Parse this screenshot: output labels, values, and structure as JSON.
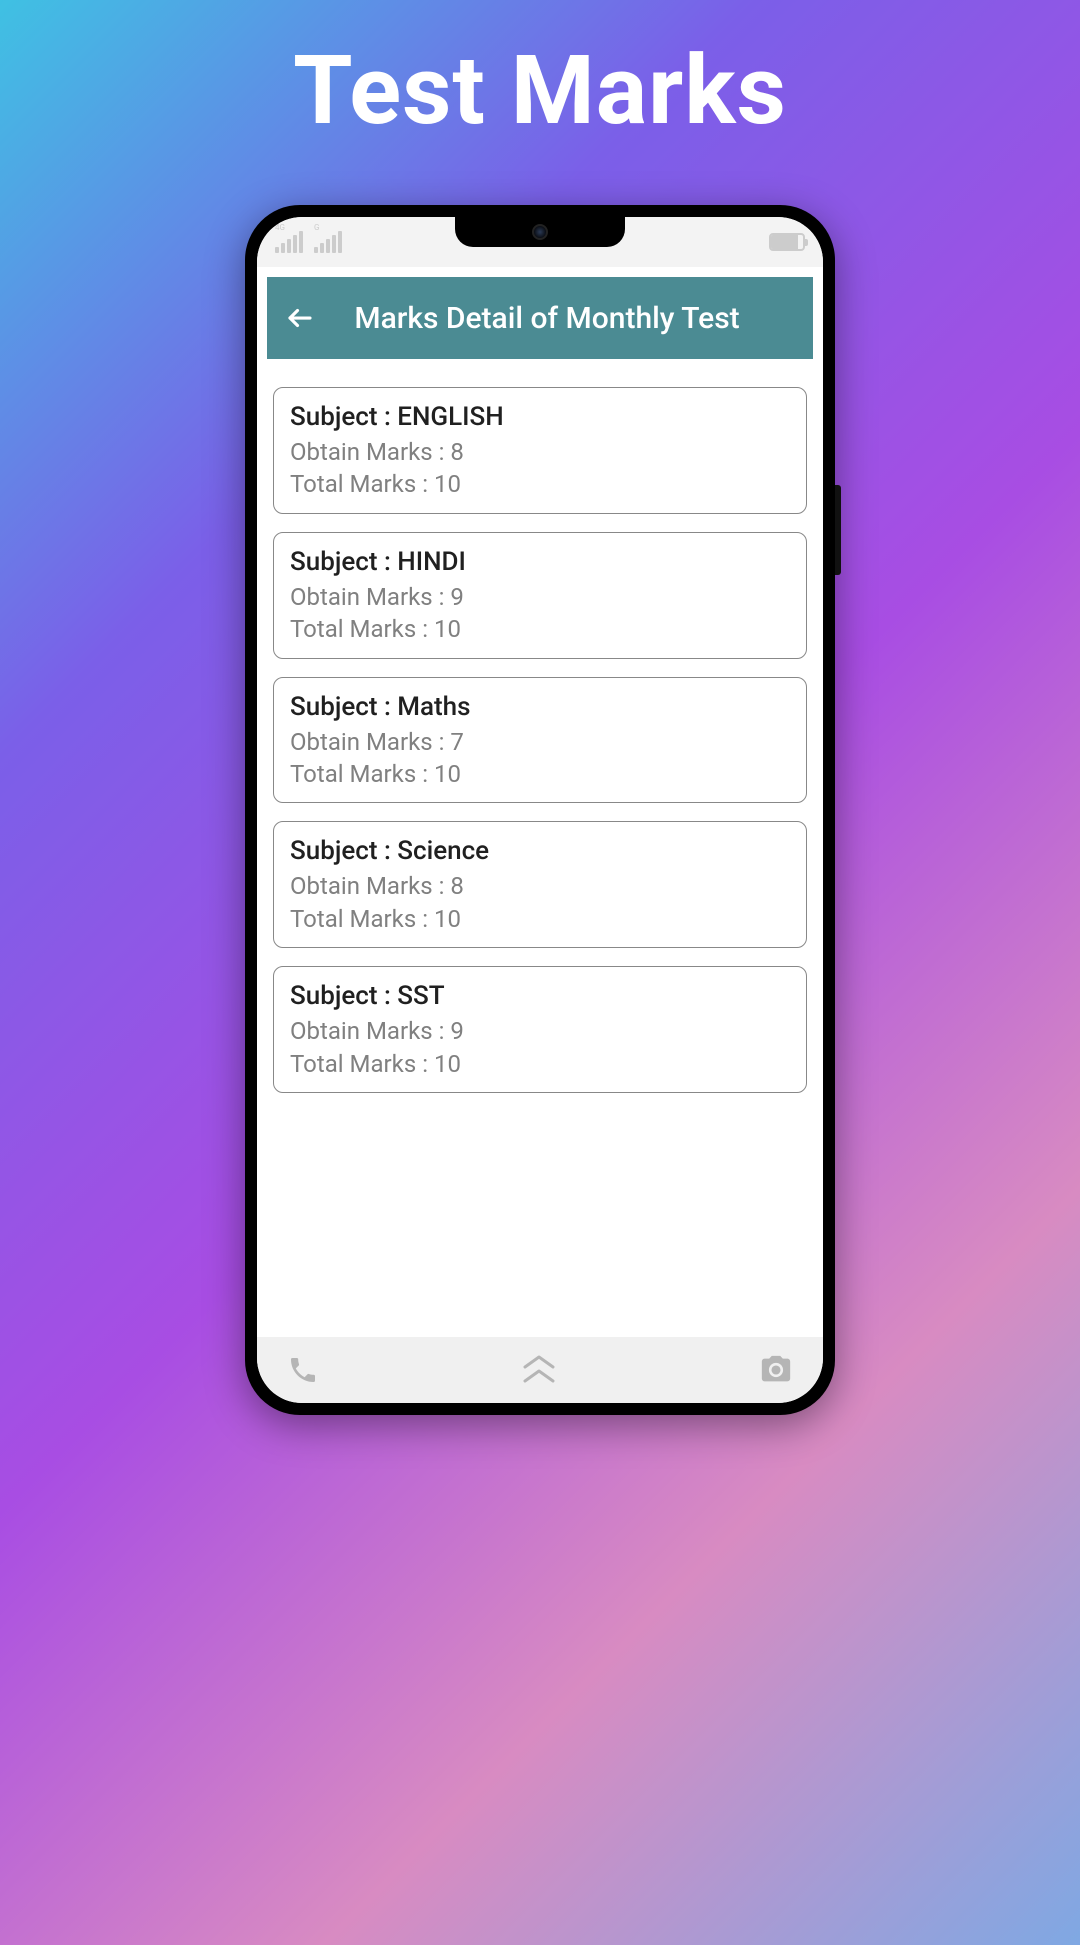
{
  "page": {
    "title": "Test Marks"
  },
  "app_bar": {
    "title": "Marks Detail of Monthly Test"
  },
  "labels": {
    "subject_prefix": "Subject : ",
    "obtain_prefix": "Obtain Marks : ",
    "total_prefix": "Total Marks : "
  },
  "marks": [
    {
      "subject": "ENGLISH",
      "obtain": "8",
      "total": "10"
    },
    {
      "subject": "HINDI",
      "obtain": "9",
      "total": "10"
    },
    {
      "subject": "Maths",
      "obtain": "7",
      "total": "10"
    },
    {
      "subject": "Science",
      "obtain": "8",
      "total": "10"
    },
    {
      "subject": "SST",
      "obtain": "9",
      "total": "10"
    }
  ],
  "colors": {
    "app_bar_bg": "#4b8b93"
  }
}
